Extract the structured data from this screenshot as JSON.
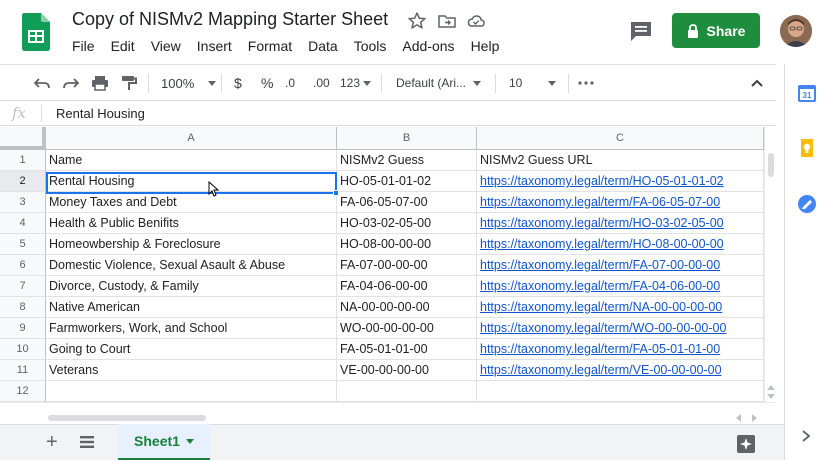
{
  "app": {
    "doc_title": "Copy of NISMv2 Mapping Starter Sheet",
    "menu": [
      "File",
      "Edit",
      "View",
      "Insert",
      "Format",
      "Data",
      "Tools",
      "Add-ons",
      "Help"
    ],
    "share_label": "Share",
    "accent_color": "#1e8e3e"
  },
  "toolbar": {
    "zoom": "100%",
    "currency": "$",
    "percent": "%",
    "decrease_decimal": ".0",
    "increase_decimal": ".00",
    "more_formats": "123",
    "font": "Default (Ari...",
    "font_size": "10"
  },
  "formula_bar": {
    "fx": "fx",
    "value": "Rental Housing"
  },
  "columns": [
    "A",
    "B",
    "C"
  ],
  "rows": [
    {
      "num": "1",
      "a": "Name",
      "b": "NISMv2 Guess",
      "c": "NISMv2 Guess URL"
    },
    {
      "num": "2",
      "a": "Rental Housing",
      "b": "HO-05-01-01-02",
      "c": "https://taxonomy.legal/term/HO-05-01-01-02"
    },
    {
      "num": "3",
      "a": "Money Taxes and Debt",
      "b": "FA-06-05-07-00",
      "c": "https://taxonomy.legal/term/FA-06-05-07-00"
    },
    {
      "num": "4",
      "a": "Health & Public Benifits",
      "b": "HO-03-02-05-00",
      "c": "https://taxonomy.legal/term/HO-03-02-05-00"
    },
    {
      "num": "5",
      "a": "Homeowbership & Foreclosure",
      "b": "HO-08-00-00-00",
      "c": "https://taxonomy.legal/term/HO-08-00-00-00"
    },
    {
      "num": "6",
      "a": "Domestic Violence, Sexual Asault & Abuse",
      "b": "FA-07-00-00-00",
      "c": "https://taxonomy.legal/term/FA-07-00-00-00"
    },
    {
      "num": "7",
      "a": "Divorce, Custody, & Family",
      "b": "FA-04-06-00-00",
      "c": "https://taxonomy.legal/term/FA-04-06-00-00"
    },
    {
      "num": "8",
      "a": "Native American",
      "b": "NA-00-00-00-00",
      "c": "https://taxonomy.legal/term/NA-00-00-00-00"
    },
    {
      "num": "9",
      "a": "Farmworkers, Work, and School",
      "b": "WO-00-00-00-00",
      "c": "https://taxonomy.legal/term/WO-00-00-00-00"
    },
    {
      "num": "10",
      "a": "Going to Court",
      "b": "FA-05-01-01-00",
      "c": "https://taxonomy.legal/term/FA-05-01-01-00"
    },
    {
      "num": "11",
      "a": "Veterans",
      "b": "VE-00-00-00-00",
      "c": "https://taxonomy.legal/term/VE-00-00-00-00"
    },
    {
      "num": "12",
      "a": "",
      "b": "",
      "c": ""
    }
  ],
  "sheets": [
    "Sheet1"
  ]
}
